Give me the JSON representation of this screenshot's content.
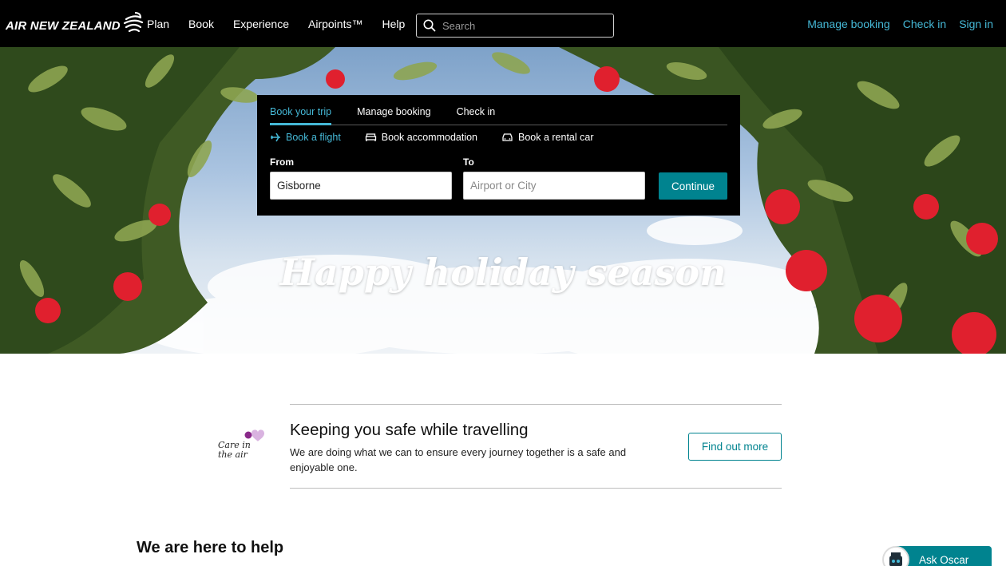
{
  "header": {
    "logo_text": "AIR NEW ZEALAND",
    "nav": [
      "Plan",
      "Book",
      "Experience",
      "Airpoints™",
      "Help"
    ],
    "search_placeholder": "Search",
    "right_links": [
      "Manage booking",
      "Check in",
      "Sign in"
    ],
    "link_color": "#45b8d6"
  },
  "hero": {
    "title": "Happy holiday season"
  },
  "booking": {
    "tabs": [
      "Book your trip",
      "Manage booking",
      "Check in"
    ],
    "active_tab": "Book your trip",
    "subtabs": [
      {
        "label": "Book a flight",
        "icon": "plane-icon"
      },
      {
        "label": "Book accommodation",
        "icon": "bed-icon"
      },
      {
        "label": "Book a rental car",
        "icon": "car-icon"
      }
    ],
    "from_label": "From",
    "from_value": "Gisborne",
    "to_label": "To",
    "to_placeholder": "Airport or City",
    "continue_label": "Continue",
    "accent_color": "#00838f"
  },
  "info": {
    "logo_text_line1": "Care in",
    "logo_text_line2": "the air",
    "title": "Keeping you safe while travelling",
    "body": "We are doing what we can to ensure every journey together is a safe and enjoyable one.",
    "button_label": "Find out more"
  },
  "help": {
    "title": "We are here to help"
  },
  "chat": {
    "label": "Ask Oscar"
  }
}
